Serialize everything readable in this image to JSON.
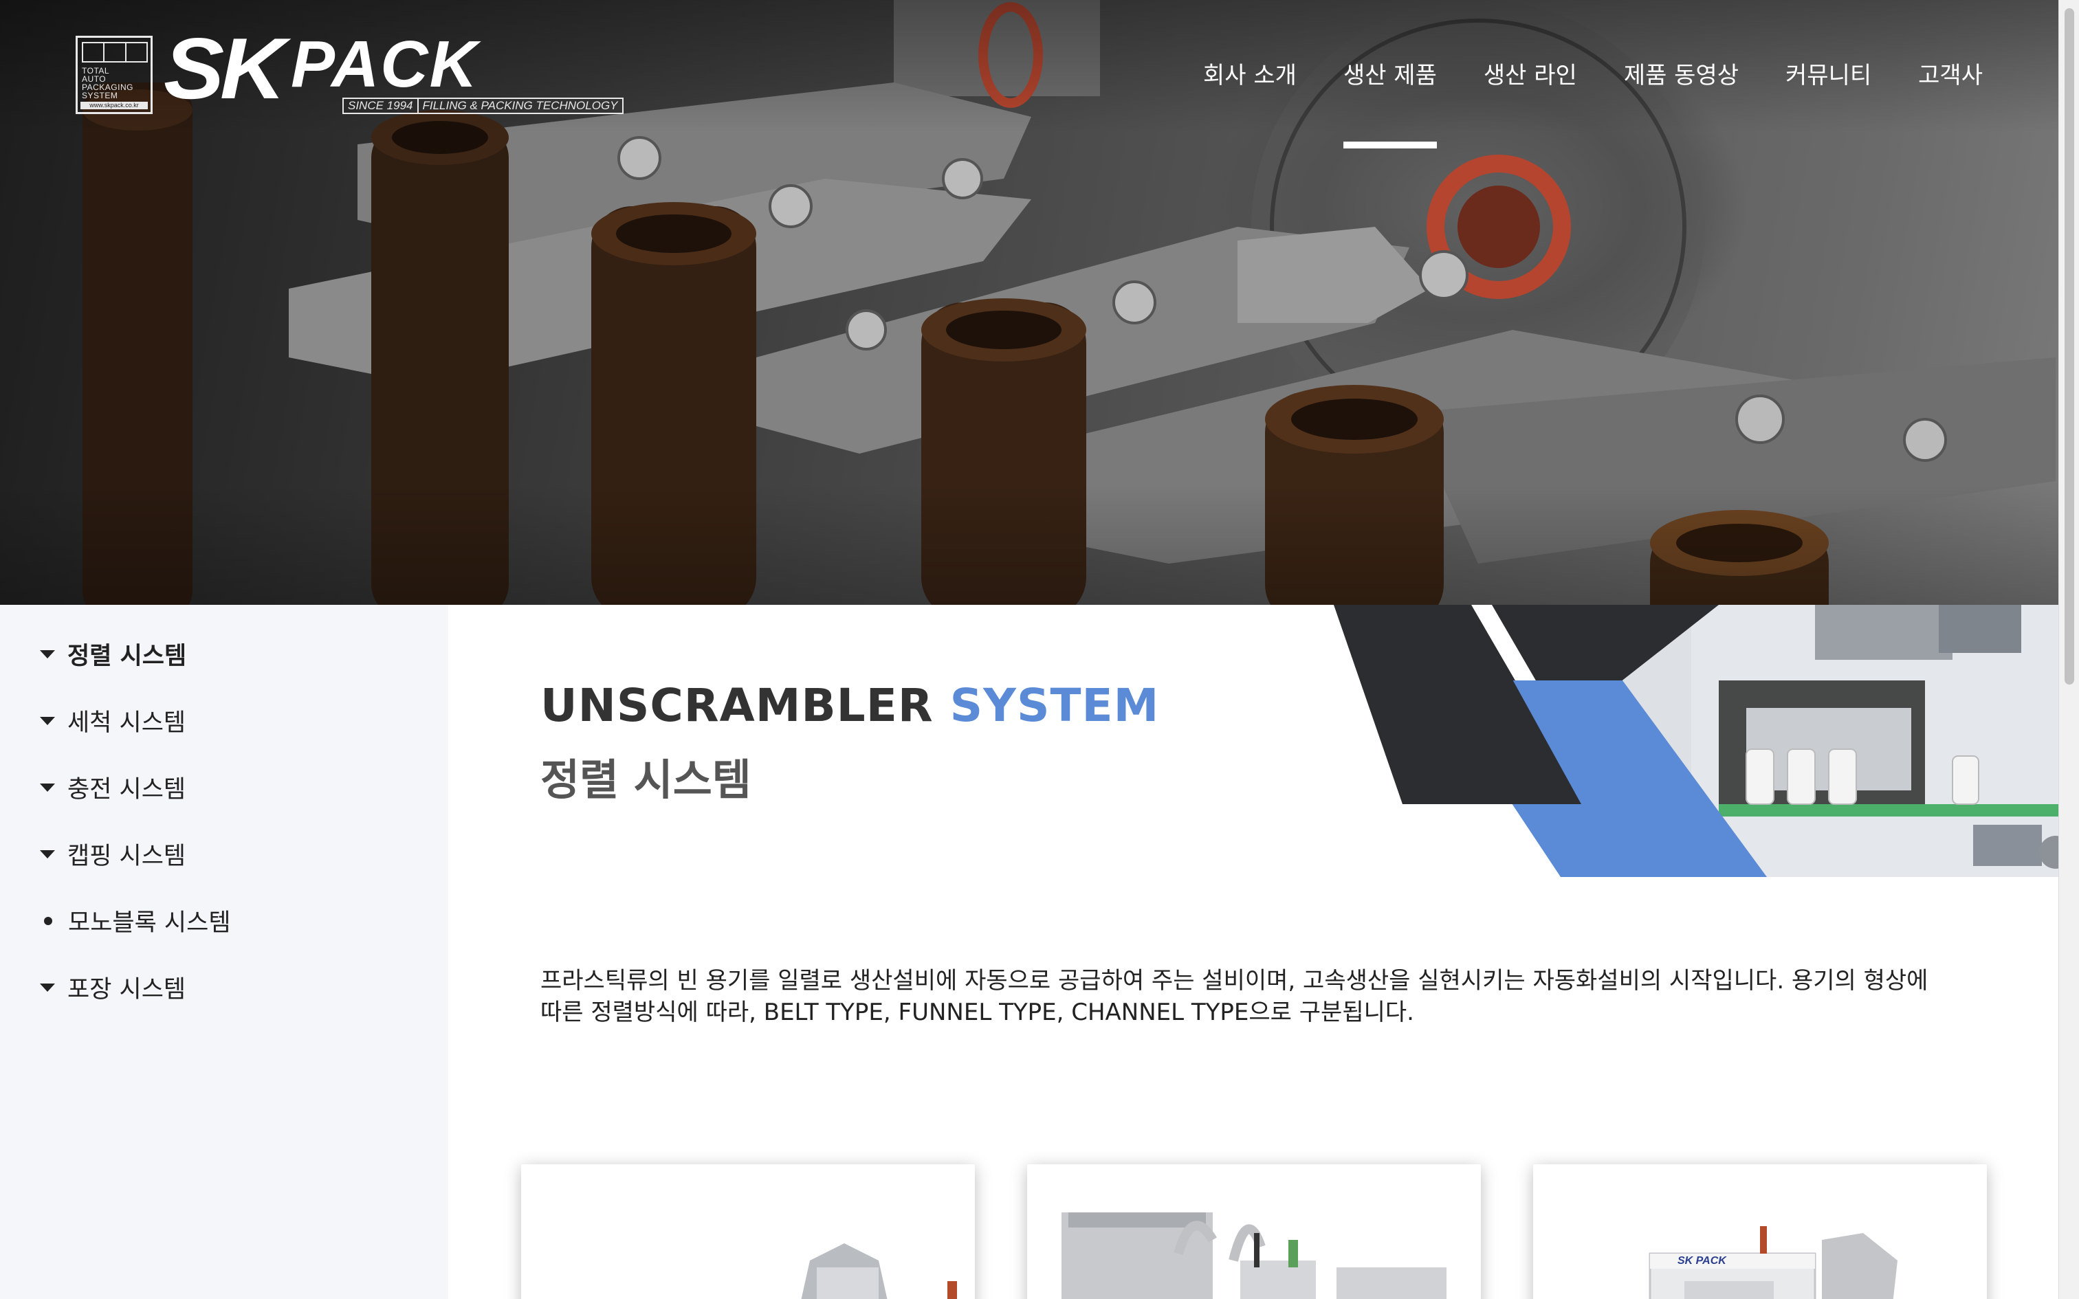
{
  "logo": {
    "badge_text": "TOTAL\nAUTO\nPACKAGING\nSYSTEM",
    "badge_site": "www.skpack.co.kr",
    "brand_sk": "SK",
    "brand_pack": "PACK",
    "since": "SINCE 1994",
    "slogan": "FILLING & PACKING TECHNOLOGY"
  },
  "nav": {
    "items": [
      {
        "label": "회사 소개"
      },
      {
        "label": "생산 제품"
      },
      {
        "label": "생산 라인"
      },
      {
        "label": "제품 동영상"
      },
      {
        "label": "커뮤니티"
      },
      {
        "label": "고객사"
      }
    ],
    "active_index": 1
  },
  "sidebar": {
    "items": [
      {
        "label": "정렬 시스템",
        "icon": "caret-down-icon",
        "active": true
      },
      {
        "label": "세척 시스템",
        "icon": "caret-down-icon"
      },
      {
        "label": "충전 시스템",
        "icon": "caret-down-icon"
      },
      {
        "label": "캡핑 시스템",
        "icon": "caret-down-icon"
      },
      {
        "label": "모노블록 시스템",
        "icon": "bullet-icon"
      },
      {
        "label": "포장 시스템",
        "icon": "caret-down-icon"
      }
    ]
  },
  "page": {
    "title_en_main": "UNSCRAMBLER",
    "title_en_accent": "SYSTEM",
    "title_ko": "정렬 시스템",
    "description": "프라스틱류의 빈 용기를 일렬로 생산설비에 자동으로 공급하여 주는 설비이며, 고속생산을 실현시키는 자동화설비의 시작입니다. 용기의 형상에 따른 정렬방식에 따라, BELT TYPE, FUNNEL TYPE, CHANNEL TYPE으로 구분됩니다."
  },
  "product_cards": [
    {
      "name": "product-card-1"
    },
    {
      "name": "product-card-2"
    },
    {
      "name": "product-card-3",
      "brand_text": "SK PACK"
    }
  ],
  "colors": {
    "accent_blue": "#5b8bd6",
    "dark_panel": "#2b2d31",
    "sidebar_bg": "#f4f6fa"
  }
}
